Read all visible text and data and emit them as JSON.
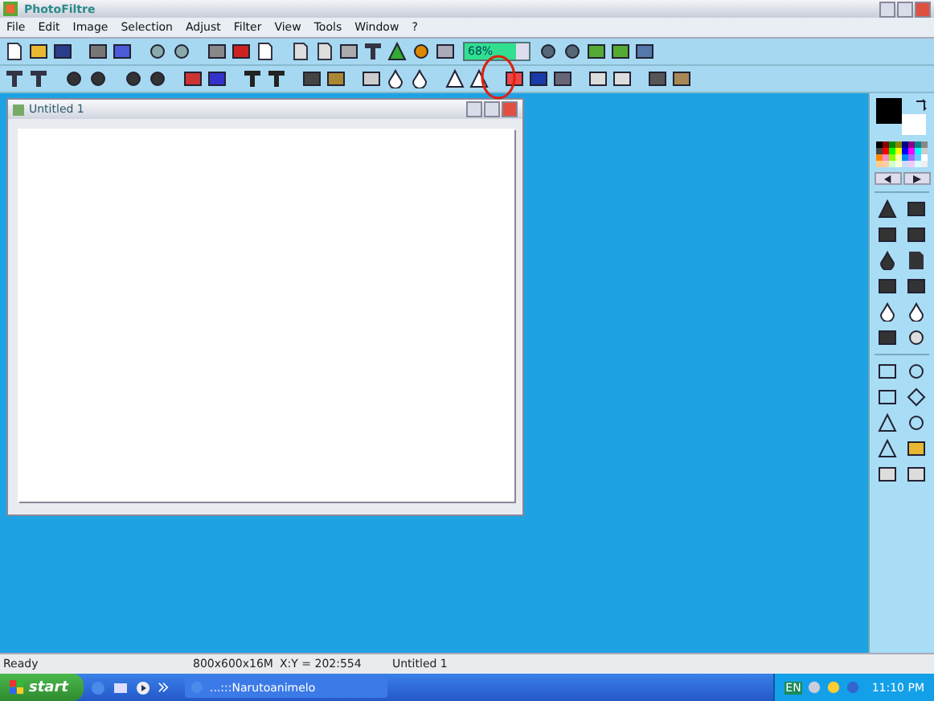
{
  "window": {
    "title": "PhotoFiltre"
  },
  "menu": [
    "File",
    "Edit",
    "Image",
    "Selection",
    "Adjust",
    "Filter",
    "View",
    "Tools",
    "Window",
    "?"
  ],
  "zoom": {
    "value": "68%"
  },
  "document_window": {
    "title": "Untitled 1"
  },
  "status_bar": [
    "Ready",
    "800x600x16M",
    "X:Y = 202:554",
    "Untitled 1"
  ],
  "taskbar": {
    "start": "start",
    "tasks": [
      {
        "label": "...:::Narutoanimelo",
        "selected": false
      }
    ],
    "language": "EN",
    "clock": "11:10 PM"
  }
}
